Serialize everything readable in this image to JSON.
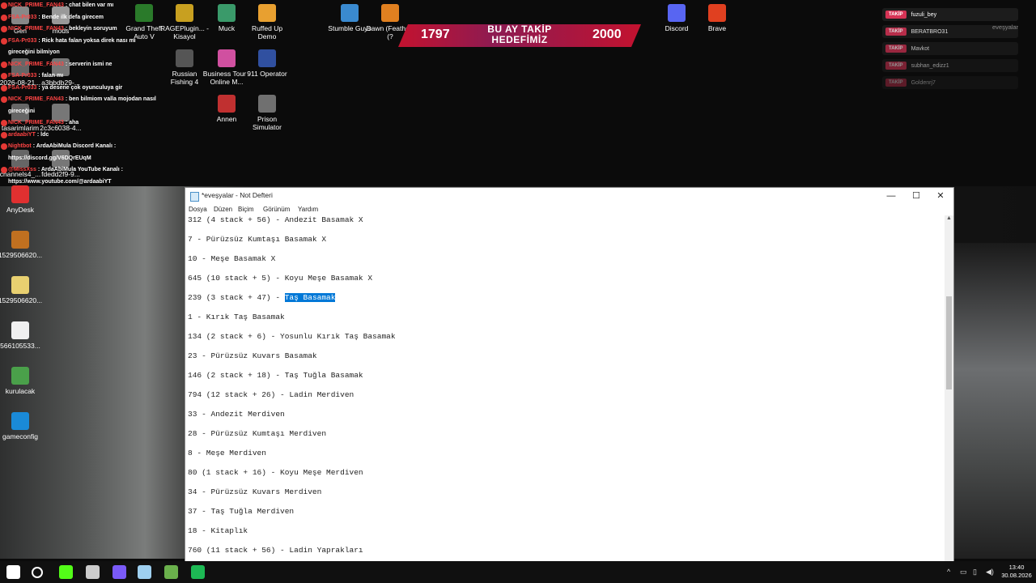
{
  "chat": [
    {
      "user": "NICK_PRIME_FAN43",
      "text": ": chat bilen var mı"
    },
    {
      "user": "FSA-Pr033",
      "text": ": Bende ilk defa girecem"
    },
    {
      "user": "NICK_PRIME_FAN43",
      "text": ": bekleyin soruyum"
    },
    {
      "user": "FSA-Pr033",
      "text": ": Rick hata falan yoksa direk nası mı"
    },
    {
      "user": "",
      "text": "gireceğini bilmiyon"
    },
    {
      "user": "NICK_PRIME_FAN43",
      "text": ": serverin ismi ne"
    },
    {
      "user": "FSA-Pr033",
      "text": ": falan mı"
    },
    {
      "user": "FSA-Pr033",
      "text": ": ya desene çok oyunculuya gir"
    },
    {
      "user": "NICK_PRIME_FAN43",
      "text": ": ben bilmiom valla mojodan nasıl"
    },
    {
      "user": "",
      "text": "gireceğini"
    },
    {
      "user": "NICK_PRIME_FAN43",
      "text": ": aha"
    },
    {
      "user": "ardaabiYT",
      "text": ": ldc"
    },
    {
      "user": "Nightbot",
      "text": ": ArdaAbiMula Discord Kanalı :"
    },
    {
      "user": "",
      "text": "https://discord.gg/V6DQrEUqM"
    },
    {
      "user": "@MissXss",
      "text": ": ArdaAbiMula YouTube Kanalı :"
    },
    {
      "user": "",
      "text": "https://www.youtube.com/@ardaabiYT"
    }
  ],
  "desktop_icons": [
    {
      "label": "Grand Theft Auto V",
      "color": "#2a7a2a"
    },
    {
      "label": "RAGEPlugin... - Kisayol",
      "color": "#c8a020"
    },
    {
      "label": "Muck",
      "color": "#3a9a6a"
    },
    {
      "label": "Ruffed Up Demo",
      "color": "#e8a030"
    },
    {
      "label": "Russian Fishing 4",
      "color": "#555555"
    },
    {
      "label": "Business Tour - Online M...",
      "color": "#d050a0"
    },
    {
      "label": "911 Operator",
      "color": "#3050a0"
    },
    {
      "label": "Annen",
      "color": "#c03030"
    },
    {
      "label": "Prison Simulator",
      "color": "#707070"
    },
    {
      "label": "Stumble Guys",
      "color": "#3a8ad0"
    },
    {
      "label": "Dawn (Feather) (?",
      "color": "#e08020"
    },
    {
      "label": "Discord",
      "color": "#5865f2"
    },
    {
      "label": "Brave",
      "color": "#e04020"
    },
    {
      "label": "AnyDesk",
      "color": "#e03030"
    },
    {
      "label": "1529506620...",
      "color": "#c07020"
    },
    {
      "label": "1529506620...",
      "color": "#e8d070"
    },
    {
      "label": "566105533...",
      "color": "#f0f0f0"
    },
    {
      "label": "kurulacak",
      "color": "#4aa04a"
    },
    {
      "label": "gameconfig",
      "color": "#1a8ad8"
    },
    {
      "label": "Gen",
      "color": "#888888"
    },
    {
      "label": "mods",
      "color": "#999999"
    },
    {
      "label": "2026-08-21...",
      "color": "#666666"
    },
    {
      "label": "a3bbdb29-...",
      "color": "#777777"
    },
    {
      "label": "tasarimlarim",
      "color": "#666666"
    },
    {
      "label": "2c3c6038-4...",
      "color": "#777777"
    },
    {
      "label": "channels4_...",
      "color": "#666666"
    },
    {
      "label": "fdedd2f9-9...",
      "color": "#777777"
    }
  ],
  "banner": {
    "left_num": "1797",
    "line1": "BU AY TAKİP",
    "line2": "HEDEFİMİZ",
    "right_num": "2000"
  },
  "follows": {
    "badge": "TAKİP",
    "users": [
      "fuzuli_bey",
      "BERATBRO31",
      "Mavkot",
      "subhan_edizz1",
      "Goldenrj7"
    ],
    "overlay_label": "eveşyalar"
  },
  "notepad": {
    "title": "*eveşyalar - Not Defteri",
    "menu": [
      "Dosya",
      "Düzen",
      "Biçim",
      "Görünüm",
      "Yardım"
    ],
    "minimize": "—",
    "maximize": "☐",
    "close": "✕",
    "lines": [
      {
        "text": "312 (4 stack + 56) - Andezit Basamak X"
      },
      {
        "text": "7 - Pürüzsüz Kumtaşı Basamak X"
      },
      {
        "text": "10 - Meşe Basamak X"
      },
      {
        "text": "645 (10 stack + 5) - Koyu Meşe Basamak X"
      },
      {
        "text": "239 (3 stack + 47) - ",
        "selected": "Taş Basamak"
      },
      {
        "text": "1 - Kırık Taş Basamak"
      },
      {
        "text": "134 (2 stack + 6) - Yosunlu Kırık Taş Basamak"
      },
      {
        "text": "23 - Pürüzsüz Kuvars Basamak"
      },
      {
        "text": "146 (2 stack + 18) - Taş Tuğla Basamak"
      },
      {
        "text": "794 (12 stack + 26) - Ladin Merdiven"
      },
      {
        "text": "33 - Andezit Merdiven"
      },
      {
        "text": "28 - Pürüzsüz Kumtaşı Merdiven"
      },
      {
        "text": "8 - Meşe Merdiven"
      },
      {
        "text": "80 (1 stack + 16) - Koyu Meşe Merdiven"
      },
      {
        "text": "34 - Pürüzsüz Kuvars Merdiven"
      },
      {
        "text": "37 - Taş Tuğla Merdiven"
      },
      {
        "text": "18 - Kitaplık"
      },
      {
        "text": "760 (11 stack + 56) - Ladin Yaprakları"
      }
    ]
  },
  "taskbar": {
    "apps": [
      {
        "name": "start-button",
        "color": "#ffffff"
      },
      {
        "name": "search-button",
        "color": "#ffffff"
      },
      {
        "name": "kick-app",
        "color": "#53fc18"
      },
      {
        "name": "obs-app",
        "color": "#cccccc"
      },
      {
        "name": "messenger-app",
        "color": "#7a5af8"
      },
      {
        "name": "notepad-app",
        "color": "#9fd0f0"
      },
      {
        "name": "minecraft-app",
        "color": "#6ab04c"
      },
      {
        "name": "spotify-app",
        "color": "#1db954"
      }
    ],
    "time": "13:40",
    "date": "30.08.2026"
  }
}
